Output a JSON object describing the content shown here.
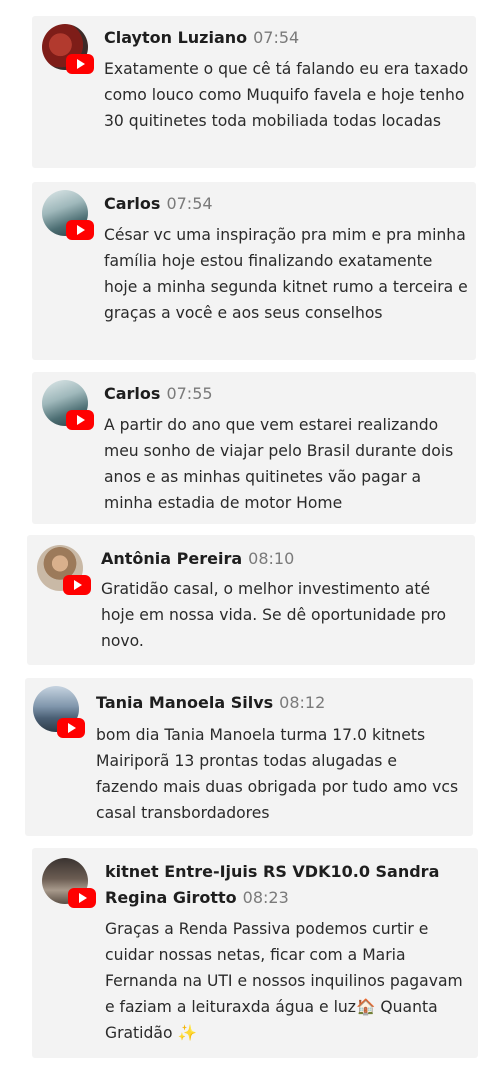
{
  "comments": [
    {
      "name": "Clayton Luziano",
      "time": "07:54",
      "text": "Exatamente o que cê tá falando eu era taxado como louco como Muquifo favela e hoje tenho 30 quitinetes toda mobiliada todas locadas",
      "avatar_icon": "avatar-photo",
      "badge_icon": "youtube-icon"
    },
    {
      "name": "Carlos",
      "time": "07:54",
      "text": "César vc uma inspiração pra mim e pra minha família hoje estou finalizando exatamente hoje a minha segunda kitnet rumo a terceira e graças a você e aos seus conselhos",
      "avatar_icon": "avatar-photo",
      "badge_icon": "youtube-icon"
    },
    {
      "name": "Carlos",
      "time": "07:55",
      "text": "A partir do ano que vem estarei realizando meu sonho de viajar pelo Brasil durante dois anos e as minhas quitinetes vão pagar a minha estadia de motor Home",
      "avatar_icon": "avatar-photo",
      "badge_icon": "youtube-icon"
    },
    {
      "name": "Antônia Pereira",
      "time": "08:10",
      "text": "Gratidão casal, o melhor investimento até hoje em nossa vida. Se dê oportunidade pro novo.",
      "avatar_icon": "avatar-photo",
      "badge_icon": "youtube-icon"
    },
    {
      "name": "Tania Manoela Silvs",
      "time": "08:12",
      "text": "bom dia Tania Manoela turma 17.0 kitnets Mairiporã 13 prontas todas alugadas e fazendo mais duas obrigada por tudo amo vcs casal transbordadores",
      "avatar_icon": "avatar-photo",
      "badge_icon": "youtube-icon"
    },
    {
      "name": "kitnet Entre-Ijuis RS VDK10.0 Sandra Regina Girotto",
      "time": "08:23",
      "text": "Graças a Renda Passiva podemos curtir e cuidar nossas netas, ficar com a Maria Fernanda na UTI e nossos inquilinos pagavam e faziam a leituraxda água e luz🏠 Quanta Gratidão ✨",
      "avatar_icon": "avatar-photo",
      "badge_icon": "youtube-icon"
    }
  ]
}
